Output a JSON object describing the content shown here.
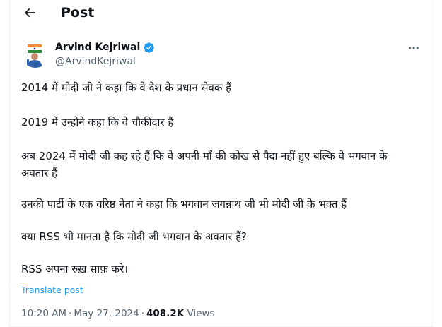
{
  "header": {
    "title": "Post",
    "back_icon": "arrow-left-icon"
  },
  "author": {
    "name": "Arvind Kejriwal",
    "handle": "@ArvindKejriwal",
    "verified_icon": "verified-badge-icon",
    "verified_color": "#1d9bf0"
  },
  "post": {
    "paragraphs": [
      "2014 में मोदी जी ने कहा कि वे देश के प्रधान सेवक हैं",
      "2019 में उन्होंने कहा कि वे चौकीदार हैं",
      "अब 2024 में मोदी जी कह रहे हैं कि वे अपनी माँ की कोख से पैदा नहीं हुए बल्कि वे भगवान के अवतार हैं",
      "उनकी पार्टी के एक वरिष्ठ नेता ने कहा कि भगवान जगन्नाथ जी भी मोदी जी के भक्त हैं",
      "क्या RSS भी मानता है कि मोदी जी भगवान के अवतार हैं?",
      "RSS अपना रुख़ साफ़ करे।"
    ],
    "translate_label": "Translate post",
    "time": "10:20 AM",
    "date": "May 27, 2024",
    "separator": "·",
    "views_count": "408.2K",
    "views_label": "Views"
  },
  "more_icon": "more-horizontal-icon",
  "colors": {
    "accent": "#1d9bf0",
    "secondary_text": "#536471",
    "primary_text": "#0f1419"
  }
}
